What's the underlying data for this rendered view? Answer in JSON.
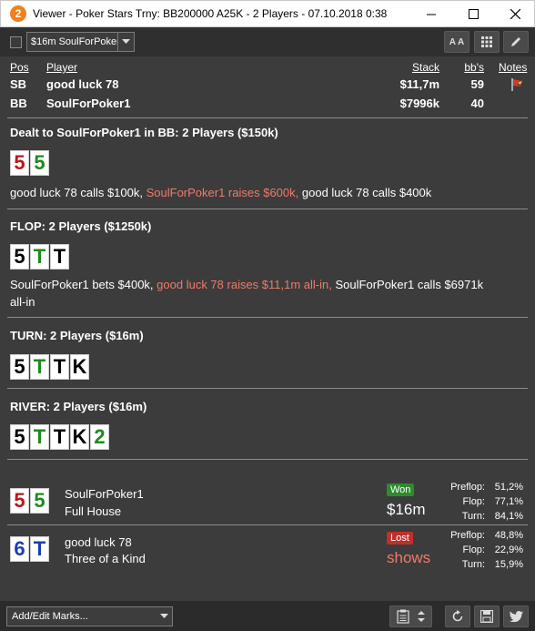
{
  "window": {
    "app_icon_text": "2",
    "title": "Viewer - Poker Stars Trny: BB200000 A25K - 2 Players - 07.10.2018 0:38"
  },
  "toolbar": {
    "hand_selector_value": "$16m SoulForPoker",
    "font_button_label": "A A"
  },
  "players_table": {
    "headers": {
      "pos": "Pos",
      "player": "Player",
      "stack": "Stack",
      "bbs": "bb's",
      "notes": "Notes"
    },
    "rows": [
      {
        "pos": "SB",
        "player": "good luck 78",
        "stack": "$11,7m",
        "bbs": "59",
        "has_note": true
      },
      {
        "pos": "BB",
        "player": "SoulForPoker1",
        "stack": "$7996k",
        "bbs": "40",
        "has_note": false
      }
    ]
  },
  "hand": {
    "preflop": {
      "title": "Dealt to SoulForPoker1 in BB: 2 Players ($150k)",
      "cards": [
        {
          "rank": "5",
          "color": "red"
        },
        {
          "rank": "5",
          "color": "green"
        }
      ],
      "actions": [
        {
          "text": "good luck 78 calls $100k,",
          "hero": false
        },
        {
          "text": "SoulForPoker1 raises $600k,",
          "hero": true
        },
        {
          "text": "good luck 78 calls $400k",
          "hero": false
        }
      ]
    },
    "flop": {
      "title": "FLOP: 2 Players ($1250k)",
      "cards": [
        {
          "rank": "5",
          "color": "black"
        },
        {
          "rank": "T",
          "color": "green"
        },
        {
          "rank": "T",
          "color": "black"
        }
      ],
      "actions": [
        {
          "text": "SoulForPoker1 bets $400k,",
          "hero": false
        },
        {
          "text": "good luck 78 raises $11,1m all-in,",
          "hero": true
        },
        {
          "text": "SoulForPoker1 calls $6971k",
          "hero": false
        },
        {
          "text": "all-in",
          "hero": false
        }
      ]
    },
    "turn": {
      "title": "TURN: 2 Players ($16m)",
      "cards": [
        {
          "rank": "5",
          "color": "black"
        },
        {
          "rank": "T",
          "color": "green"
        },
        {
          "rank": "T",
          "color": "black"
        },
        {
          "rank": "K",
          "color": "black"
        }
      ]
    },
    "river": {
      "title": "RIVER: 2 Players ($16m)",
      "cards": [
        {
          "rank": "5",
          "color": "black"
        },
        {
          "rank": "T",
          "color": "green"
        },
        {
          "rank": "T",
          "color": "black"
        },
        {
          "rank": "K",
          "color": "black"
        },
        {
          "rank": "2",
          "color": "green"
        }
      ]
    }
  },
  "results": [
    {
      "cards": [
        {
          "rank": "5",
          "color": "red"
        },
        {
          "rank": "5",
          "color": "green"
        }
      ],
      "player": "SoulForPoker1",
      "hand_name": "Full House",
      "outcome": "Won",
      "amount": "$16m",
      "equity": [
        {
          "label": "Preflop:",
          "value": "51,2%"
        },
        {
          "label": "Flop:",
          "value": "77,1%"
        },
        {
          "label": "Turn:",
          "value": "84,1%"
        }
      ]
    },
    {
      "cards": [
        {
          "rank": "6",
          "color": "blue"
        },
        {
          "rank": "T",
          "color": "blue"
        }
      ],
      "player": "good luck 78",
      "hand_name": "Three of a Kind",
      "outcome": "Lost",
      "amount": "shows",
      "equity": [
        {
          "label": "Preflop:",
          "value": "48,8%"
        },
        {
          "label": "Flop:",
          "value": "22,9%"
        },
        {
          "label": "Turn:",
          "value": "15,9%"
        }
      ]
    }
  ],
  "bottom": {
    "marks_placeholder": "Add/Edit Marks..."
  },
  "colors": {
    "background": "#3c3c3c",
    "hero_action": "#f07a6a",
    "won_badge": "#2f8a2f",
    "lost_badge": "#c0302b",
    "lost_amount": "#f07a6a"
  }
}
